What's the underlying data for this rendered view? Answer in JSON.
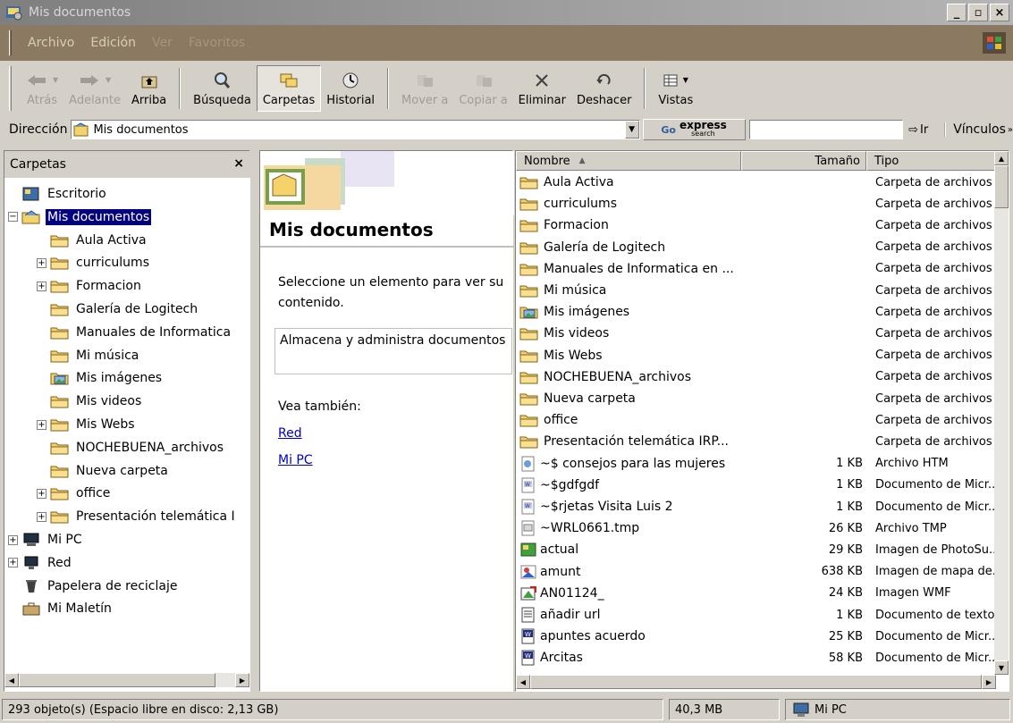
{
  "window": {
    "title": "Mis documentos"
  },
  "menu": [
    {
      "label": "Archivo",
      "dim": false
    },
    {
      "label": "Edición",
      "dim": false
    },
    {
      "label": "Ver",
      "dim": true
    },
    {
      "label": "Favoritos",
      "dim": true
    }
  ],
  "toolbar": {
    "back": "Atrás",
    "forward": "Adelante",
    "up": "Arriba",
    "search": "Búsqueda",
    "folders": "Carpetas",
    "history": "Historial",
    "move_to": "Mover a",
    "copy_to": "Copiar a",
    "delete": "Eliminar",
    "undo": "Deshacer",
    "views": "Vistas"
  },
  "address": {
    "label": "Dirección",
    "value": "Mis documentos",
    "express_label": "express",
    "express_sub": "search",
    "go": "Ir",
    "links": "Vínculos"
  },
  "folders_pane": {
    "title": "Carpetas",
    "close": "×",
    "tree": [
      {
        "label": "Escritorio",
        "level": 0,
        "expander": "",
        "icon": "desktop"
      },
      {
        "label": "Mis documentos",
        "level": 0,
        "expander": "−",
        "icon": "mydocs",
        "selected": true
      },
      {
        "label": "Aula Activa",
        "level": 1,
        "expander": "",
        "icon": "folder"
      },
      {
        "label": "curriculums",
        "level": 1,
        "expander": "+",
        "icon": "folder"
      },
      {
        "label": "Formacion",
        "level": 1,
        "expander": "+",
        "icon": "folder"
      },
      {
        "label": "Galería de Logitech",
        "level": 1,
        "expander": "",
        "icon": "folder"
      },
      {
        "label": "Manuales de Informatica",
        "level": 1,
        "expander": "",
        "icon": "folder"
      },
      {
        "label": "Mi música",
        "level": 1,
        "expander": "",
        "icon": "folder"
      },
      {
        "label": "Mis imágenes",
        "level": 1,
        "expander": "",
        "icon": "picfolder"
      },
      {
        "label": "Mis videos",
        "level": 1,
        "expander": "",
        "icon": "folder"
      },
      {
        "label": "Mis Webs",
        "level": 1,
        "expander": "+",
        "icon": "folder"
      },
      {
        "label": "NOCHEBUENA_archivos",
        "level": 1,
        "expander": "",
        "icon": "folder"
      },
      {
        "label": "Nueva carpeta",
        "level": 1,
        "expander": "",
        "icon": "folder"
      },
      {
        "label": "office",
        "level": 1,
        "expander": "+",
        "icon": "folder"
      },
      {
        "label": "Presentación telemática I",
        "level": 1,
        "expander": "+",
        "icon": "folder"
      },
      {
        "label": "Mi PC",
        "level": 0,
        "expander": "+",
        "icon": "pc"
      },
      {
        "label": "Red",
        "level": 0,
        "expander": "+",
        "icon": "network"
      },
      {
        "label": "Papelera de reciclaje",
        "level": 0,
        "expander": "",
        "icon": "recycle"
      },
      {
        "label": "Mi Maletín",
        "level": 0,
        "expander": "",
        "icon": "briefcase"
      }
    ]
  },
  "webview": {
    "title": "Mis documentos",
    "select_hint": "Seleccione un elemento para ver su contenido.",
    "description": "Almacena y administra documentos",
    "see_also": "Vea también:",
    "links": [
      "Red",
      "Mi PC"
    ]
  },
  "list": {
    "columns": {
      "name": "Nombre",
      "size": "Tamaño",
      "type": "Tipo"
    },
    "rows": [
      {
        "name": "Aula Activa",
        "size": "",
        "type": "Carpeta de archivos",
        "icon": "folder"
      },
      {
        "name": "curriculums",
        "size": "",
        "type": "Carpeta de archivos",
        "icon": "folder"
      },
      {
        "name": "Formacion",
        "size": "",
        "type": "Carpeta de archivos",
        "icon": "folder"
      },
      {
        "name": "Galería de Logitech",
        "size": "",
        "type": "Carpeta de archivos",
        "icon": "folder"
      },
      {
        "name": "Manuales de Informatica en ...",
        "size": "",
        "type": "Carpeta de archivos",
        "icon": "folder"
      },
      {
        "name": "Mi música",
        "size": "",
        "type": "Carpeta de archivos",
        "icon": "folder"
      },
      {
        "name": "Mis imágenes",
        "size": "",
        "type": "Carpeta de archivos",
        "icon": "picfolder"
      },
      {
        "name": "Mis videos",
        "size": "",
        "type": "Carpeta de archivos",
        "icon": "folder"
      },
      {
        "name": "Mis Webs",
        "size": "",
        "type": "Carpeta de archivos",
        "icon": "folder"
      },
      {
        "name": "NOCHEBUENA_archivos",
        "size": "",
        "type": "Carpeta de archivos",
        "icon": "folder"
      },
      {
        "name": "Nueva carpeta",
        "size": "",
        "type": "Carpeta de archivos",
        "icon": "folder"
      },
      {
        "name": "office",
        "size": "",
        "type": "Carpeta de archivos",
        "icon": "folder"
      },
      {
        "name": "Presentación telemática IRP...",
        "size": "",
        "type": "Carpeta de archivos",
        "icon": "folder"
      },
      {
        "name": "~$ consejos para las mujeres",
        "size": "1 KB",
        "type": "Archivo HTM",
        "icon": "htm"
      },
      {
        "name": "~$gdfgdf",
        "size": "1 KB",
        "type": "Documento de Micr...",
        "icon": "word"
      },
      {
        "name": "~$rjetas Visita Luis 2",
        "size": "1 KB",
        "type": "Documento de Micr...",
        "icon": "word"
      },
      {
        "name": "~WRL0661.tmp",
        "size": "26 KB",
        "type": "Archivo TMP",
        "icon": "tmp"
      },
      {
        "name": "actual",
        "size": "29 KB",
        "type": "Imagen de PhotoSu...",
        "icon": "photo"
      },
      {
        "name": "amunt",
        "size": "638 KB",
        "type": "Imagen de mapa de...",
        "icon": "bmp"
      },
      {
        "name": "AN01124_",
        "size": "24 KB",
        "type": "Imagen WMF",
        "icon": "wmf"
      },
      {
        "name": "añadir url",
        "size": "1 KB",
        "type": "Documento de texto",
        "icon": "txt"
      },
      {
        "name": "apuntes acuerdo",
        "size": "25 KB",
        "type": "Documento de Micr...",
        "icon": "worddoc"
      },
      {
        "name": "Arcitas",
        "size": "58 KB",
        "type": "Documento de Micr...",
        "icon": "worddoc"
      }
    ]
  },
  "status": {
    "objects": "293 objeto(s) (Espacio libre en disco: 2,13 GB)",
    "size": "40,3 MB",
    "zone": "Mi PC"
  },
  "colors": {
    "selection": "#000080",
    "menubar": "#8b7962",
    "face": "#d4d0c8",
    "folder": "#f4d36b"
  }
}
